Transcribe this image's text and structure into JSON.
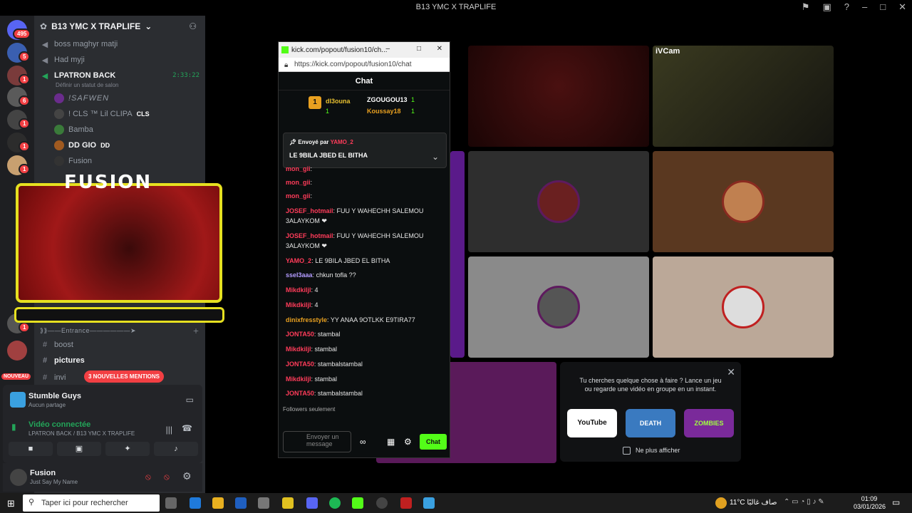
{
  "window": {
    "title": "B13 YMC X TRAPLIFE"
  },
  "server": {
    "name": "B13 YMC X TRAPLIFE",
    "home_badge": "495",
    "new_label": "NOUVEAU",
    "mention_banner": "3 NOUVELLES MENTIONS"
  },
  "serverbar": {
    "badges": [
      "5",
      "1",
      "6",
      "1",
      "1",
      "1",
      "1",
      "1"
    ]
  },
  "channels": {
    "items": [
      {
        "name": "boss maghyr matji"
      },
      {
        "name": "Had myji"
      },
      {
        "name": "LPATRON BACK",
        "timer": "2:33:22",
        "status": "Définir un statut de salon"
      }
    ],
    "voice_users": [
      {
        "name": "!SAFWEN"
      },
      {
        "name": "! CLS ™ Lil CLIPA",
        "tag": "CLS"
      },
      {
        "name": "Bamba"
      },
      {
        "name": "DD GIO",
        "tag": "DD"
      },
      {
        "name": "Fusion"
      }
    ],
    "divider": "⟫⟫——Entrance——————➤",
    "text": [
      {
        "name": "boost"
      },
      {
        "name": "pictures"
      },
      {
        "name": "invi"
      }
    ]
  },
  "activity": {
    "name": "Stumble Guys",
    "sub": "Aucun partage"
  },
  "voice": {
    "status": "Vidéo connectée",
    "where": "LPATRON BACK / B13 YMC X TRAPLIFE"
  },
  "user": {
    "name": "Fusion",
    "status": "Just Say My Name"
  },
  "overlay": {
    "title": "FUSION"
  },
  "kick": {
    "url_short": "kick.com/popout/fusion10/ch...",
    "url": "https://kick.com/popout/fusion10/chat",
    "header": "Chat",
    "leaders": [
      {
        "rank": "1",
        "name": "dl3ouna",
        "count": "1"
      },
      {
        "name": "ZGOUGOU13",
        "count": "1"
      },
      {
        "name": "Koussay18",
        "count": "1"
      }
    ],
    "pinned": {
      "label": "Envoyé par",
      "by": "YAMO_2",
      "text": "LE 9BILA JBED EL BITHA"
    },
    "messages": [
      {
        "user": "mon_gii",
        "text": ""
      },
      {
        "user": "mon_gii",
        "text": ""
      },
      {
        "user": "mon_gii",
        "text": ""
      },
      {
        "user": "JOSEF_hotmail",
        "text": "FUU Y WAHECHH SALEMOU 3ALAYKOM ❤"
      },
      {
        "user": "JOSEF_hotmail",
        "text": "FUU Y WAHECHH SALEMOU 3ALAYKOM ❤"
      },
      {
        "user": "YAMO_2",
        "text": "LE 9BILA JBED EL BITHA"
      },
      {
        "user": "ssel3aaa",
        "text": "chkun tofla ??"
      },
      {
        "user": "Mikdkiljl",
        "text": "4"
      },
      {
        "user": "Mikdkiljl",
        "text": "4"
      },
      {
        "user": "dinixfresstyle",
        "text": "YY ANAA 9OTLKK E9TIRA77"
      },
      {
        "user": "JONTA50",
        "text": "stambal"
      },
      {
        "user": "Mikdkiljl",
        "text": "stambal"
      },
      {
        "user": "JONTA50",
        "text": "stambalstambal"
      },
      {
        "user": "Mikdkiljl",
        "text": "stambal"
      },
      {
        "user": "JONTA50",
        "text": "stambalstambal"
      }
    ],
    "followers": "Followers seulement",
    "input_placeholder": "Envoyer un message",
    "send": "Chat"
  },
  "stage": {
    "cam_label": "iVCam"
  },
  "suggest": {
    "text": "Tu cherches quelque chose à faire ? Lance un jeu ou regarde une vidéo en groupe en un instant.",
    "cards": [
      "YouTube",
      "DEATH",
      "ZOMBIES"
    ],
    "checkbox": "Ne plus afficher"
  },
  "taskbar": {
    "search": "Taper ici pour rechercher",
    "weather": "11°C صاف غالبًا",
    "time": "01:09",
    "date": "03/01/2026"
  }
}
